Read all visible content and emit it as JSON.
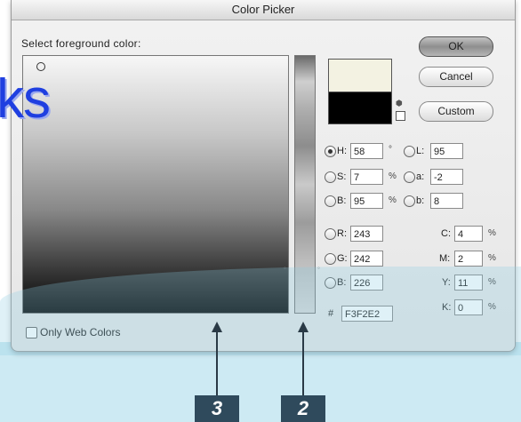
{
  "window": {
    "title": "Color Picker"
  },
  "picker": {
    "label": "Select foreground color:"
  },
  "buttons": {
    "ok": "OK",
    "cancel": "Cancel",
    "custom": "Custom"
  },
  "hsb": {
    "h": {
      "label": "H:",
      "value": "58",
      "unit": "°"
    },
    "s": {
      "label": "S:",
      "value": "7",
      "unit": "%"
    },
    "b": {
      "label": "B:",
      "value": "95",
      "unit": "%"
    }
  },
  "lab": {
    "l": {
      "label": "L:",
      "value": "95"
    },
    "a": {
      "label": "a:",
      "value": "-2"
    },
    "b": {
      "label": "b:",
      "value": "8"
    }
  },
  "rgb": {
    "r": {
      "label": "R:",
      "value": "243"
    },
    "g": {
      "label": "G:",
      "value": "242"
    },
    "b": {
      "label": "B:",
      "value": "226"
    }
  },
  "cmyk": {
    "c": {
      "label": "C:",
      "value": "4",
      "unit": "%"
    },
    "m": {
      "label": "M:",
      "value": "2",
      "unit": "%"
    },
    "y": {
      "label": "Y:",
      "value": "11",
      "unit": "%"
    },
    "k": {
      "label": "K:",
      "value": "0",
      "unit": "%"
    }
  },
  "hex": {
    "label": "#",
    "value": "F3F2E2"
  },
  "web_only": {
    "label": "Only Web Colors"
  },
  "overlay": {
    "partial_text": "ks"
  },
  "callouts": {
    "field": "3",
    "slider": "2"
  },
  "colors": {
    "new_color": "#f3f2e2",
    "old_color": "#000000",
    "callout_bg": "#2f4a5c"
  }
}
